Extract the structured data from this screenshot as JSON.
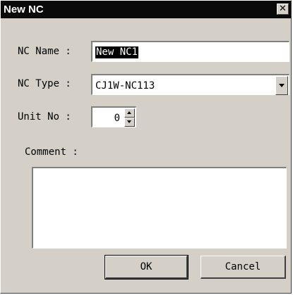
{
  "window": {
    "title": "New NC",
    "close_glyph": "✕"
  },
  "form": {
    "nc_name_label": "NC Name :",
    "nc_name_value": "New NC1",
    "nc_type_label": "NC Type :",
    "nc_type_value": "CJ1W-NC113",
    "unit_no_label": "Unit No :",
    "unit_no_value": "0",
    "comment_label": "Comment :",
    "comment_value": ""
  },
  "buttons": {
    "ok_label": "OK",
    "cancel_label": "Cancel"
  },
  "icons": {
    "close": "close-icon",
    "dropdown": "chevron-down-icon",
    "spin_up": "spin-up-icon",
    "spin_down": "spin-down-icon"
  },
  "colors": {
    "titlebar_bg": "#0a0a0a",
    "dialog_bg": "#d4d0c8",
    "selection_bg": "#000000"
  }
}
